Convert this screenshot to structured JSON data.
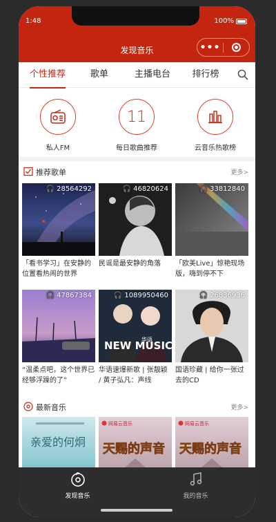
{
  "status": {
    "time": "1:48",
    "battery": "100%"
  },
  "navbar": {
    "title": "发现音乐"
  },
  "tabs": [
    {
      "label": "个性推荐",
      "active": true
    },
    {
      "label": "歌单"
    },
    {
      "label": "主播电台"
    },
    {
      "label": "排行榜"
    }
  ],
  "quick": [
    {
      "label": "私人FM",
      "icon": "radio-icon"
    },
    {
      "label": "每日歌曲推荐",
      "day": "11",
      "icon": "calendar-icon"
    },
    {
      "label": "云音乐热歌榜",
      "icon": "chart-bars-icon"
    }
  ],
  "playlists_section": {
    "title": "推荐歌单",
    "more": "更多>"
  },
  "playlists": [
    {
      "plays": "28564292",
      "title": "「看书学习」在安静的位置看热闹的世界"
    },
    {
      "plays": "46820624",
      "title": "民谣是最安静的角落"
    },
    {
      "plays": "33812840",
      "title": "「欧美Live」惊艳现场版，嗨到停不下"
    },
    {
      "plays": "47867384",
      "title": "“温柔点吧，这个世界已经够浮躁的了”"
    },
    {
      "plays": "1089950460",
      "title": "华语速爆新歌 | 张靓颖 / 黄子弘凡：声线"
    },
    {
      "plays": "26836936",
      "title": "国语珍藏 | 给你一张过去的CD"
    }
  ],
  "new_music_section": {
    "title": "最新音乐",
    "more": "更多>"
  },
  "new_music": [
    {
      "cover_text": "亲爱的何炯"
    },
    {
      "badge": "网易云音乐",
      "cover_text": "天赐的声音"
    },
    {
      "badge": "网易云音乐",
      "cover_text": "天赐的声音"
    }
  ],
  "tabbar": [
    {
      "label": "发现音乐",
      "active": true
    },
    {
      "label": "我的音乐"
    }
  ],
  "cover_badge": "NEW MUSIC",
  "cover_badge_sub": "华语",
  "colors": {
    "brand": "#c3250e",
    "tabbar": "#2d2d2d"
  }
}
